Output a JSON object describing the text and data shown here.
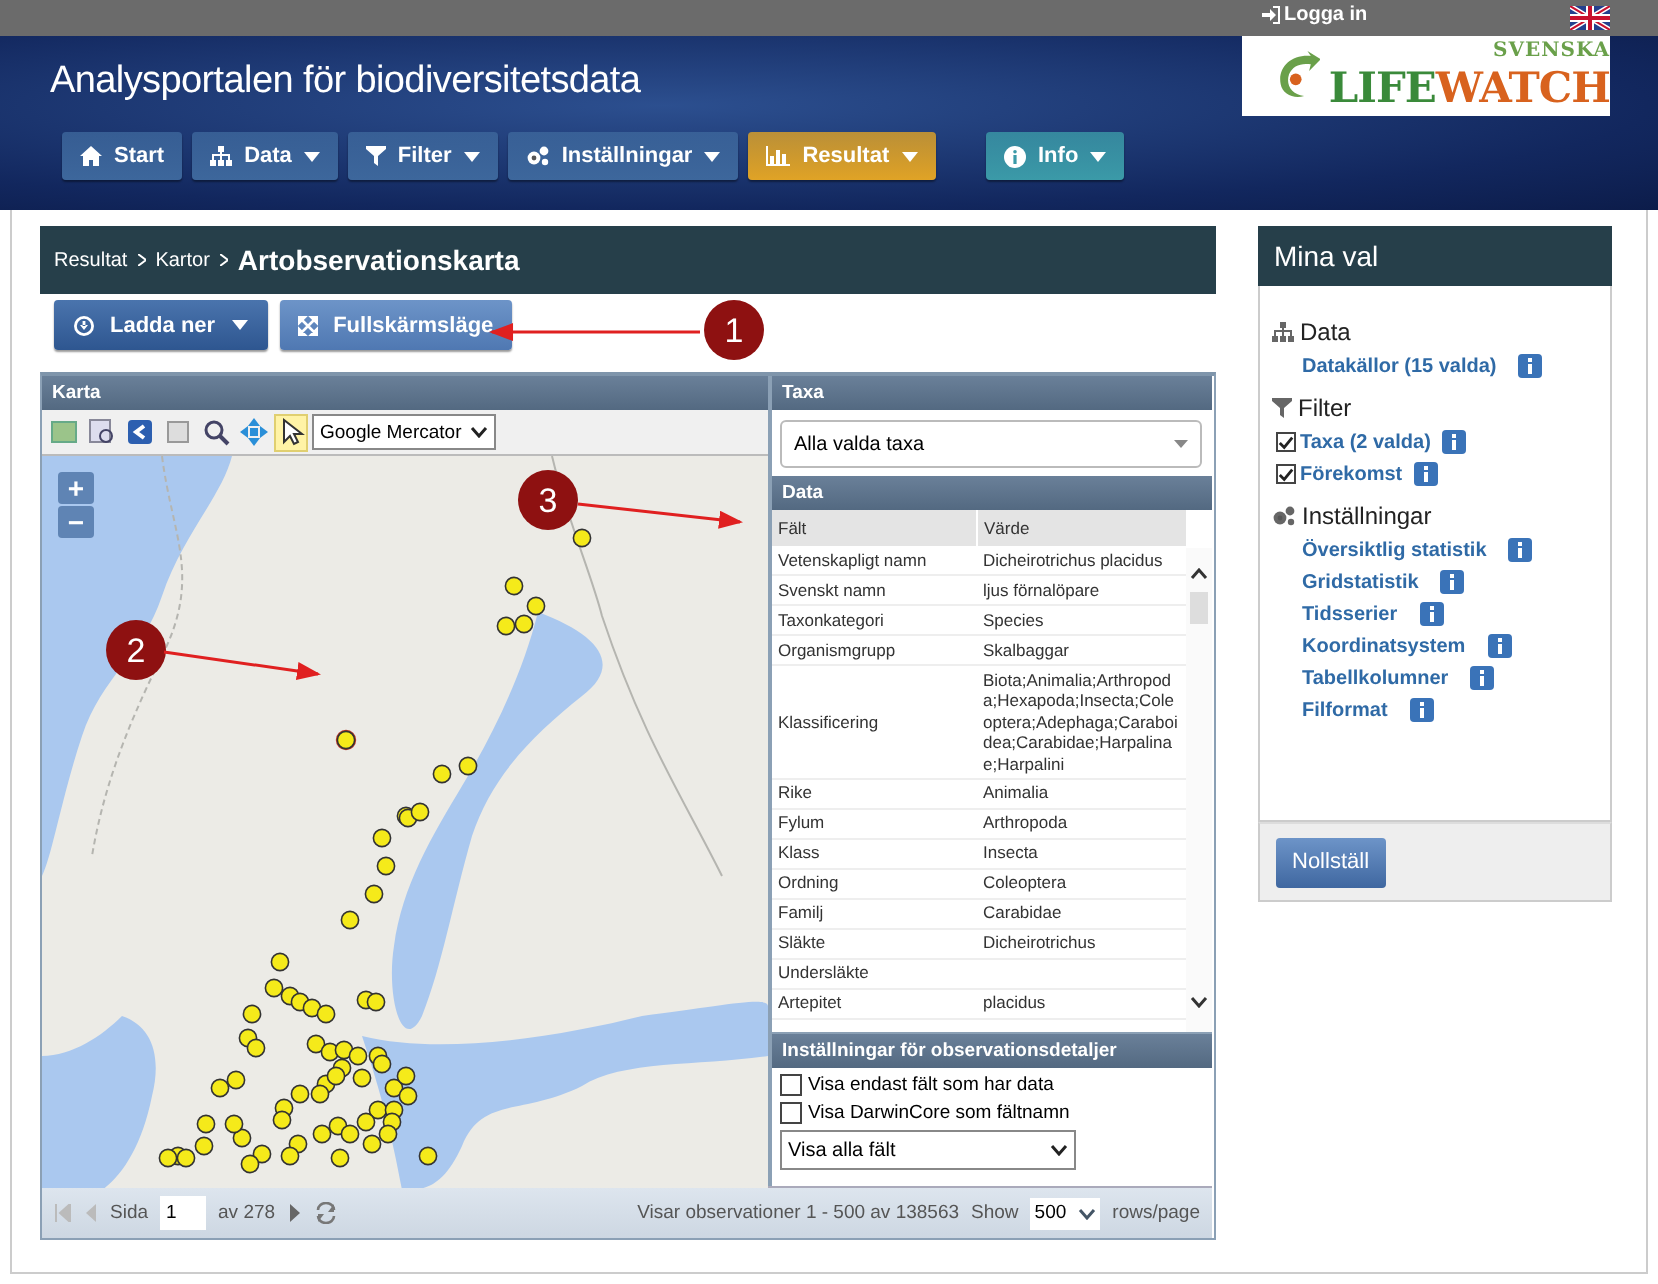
{
  "topbar": {
    "login": "Logga in"
  },
  "header": {
    "title": "Analysportalen för biodiversitetsdata",
    "logo": {
      "top": "SVENSKA",
      "main_1": "LIFE",
      "main_2": "WATCH"
    }
  },
  "nav": [
    {
      "label": "Start",
      "dropdown": false,
      "color": "#3d679c"
    },
    {
      "label": "Data",
      "dropdown": true,
      "color": "#3d679c"
    },
    {
      "label": "Filter",
      "dropdown": true,
      "color": "#3d679c"
    },
    {
      "label": "Inställningar",
      "dropdown": true,
      "color": "#3d679c"
    },
    {
      "label": "Resultat",
      "dropdown": true,
      "color": "#e0a326"
    }
  ],
  "nav_right": [
    {
      "label": "Info",
      "dropdown": true,
      "color": "#3b9aa8"
    }
  ],
  "breadcrumb": [
    "Resultat",
    "Kartor",
    "Artobservationskarta"
  ],
  "actions": [
    {
      "label": "Ladda ner",
      "kind": "download"
    },
    {
      "label": "Fullskärmsläge",
      "kind": "fullscreen"
    }
  ],
  "map": {
    "title": "Karta",
    "tools": [
      {
        "selected": false
      },
      {
        "selected": false
      },
      {
        "selected": false
      },
      {
        "selected": false
      },
      {
        "selected": false
      },
      {
        "selected": false
      },
      {
        "selected": true
      }
    ],
    "projection": "Google Mercator",
    "zoom_in": "+",
    "zoom_out": "−"
  },
  "taxa": {
    "title": "Taxa",
    "value": "Alla valda taxa"
  },
  "data_table": {
    "title": "Data",
    "columns": [
      "Fält",
      "Värde"
    ],
    "rows": [
      {
        "field": "Vetenskapligt namn",
        "value": "Dicheirotrichus placidus"
      },
      {
        "field": "Svenskt namn",
        "value": "ljus förnalöpare"
      },
      {
        "field": "Taxonkategori",
        "value": "Species"
      },
      {
        "field": "Organismgrupp",
        "value": "Skalbaggar"
      },
      {
        "field": "Klassificering",
        "value": "Biota;Animalia;Arthropoda;Hexapoda;Insecta;Coleoptera;Adephaga;Caraboidea;Carabidae;Harpalinae;Harpalini"
      },
      {
        "field": "Rike",
        "value": "Animalia"
      },
      {
        "field": "Fylum",
        "value": "Arthropoda"
      },
      {
        "field": "Klass",
        "value": "Insecta"
      },
      {
        "field": "Ordning",
        "value": "Coleoptera"
      },
      {
        "field": "Familj",
        "value": "Carabidae"
      },
      {
        "field": "Släkte",
        "value": "Dicheirotrichus"
      },
      {
        "field": "Undersläkte",
        "value": ""
      },
      {
        "field": "Artepitet",
        "value": "placidus"
      }
    ]
  },
  "details_settings": {
    "title": "Inställningar för observationsdetaljer",
    "options": [
      {
        "label": "Visa endast fält som har data",
        "checked": false
      },
      {
        "label": "Visa DarwinCore som fältnamn",
        "checked": false
      }
    ],
    "select": "Visa alla fält"
  },
  "pager": {
    "page_label": "Sida",
    "page": "1",
    "of": "av 278",
    "summary": "Visar observationer 1 - 500 av 138563",
    "show_label": "Show",
    "page_size": "500",
    "unit": "rows/page"
  },
  "callouts": [
    "1",
    "2",
    "3"
  ],
  "sidebar": {
    "title": "Mina val",
    "sections": [
      {
        "title": "Data",
        "items": [
          {
            "label": "Datakällor (15 valda)",
            "kind": "link"
          }
        ]
      },
      {
        "title": "Filter",
        "items": [
          {
            "label": "Taxa (2 valda)",
            "kind": "checkbox",
            "checked": true
          },
          {
            "label": "Förekomst",
            "kind": "checkbox",
            "checked": true
          }
        ]
      },
      {
        "title": "Inställningar",
        "items": [
          {
            "label": "Översiktlig statistik",
            "kind": "link"
          },
          {
            "label": "Gridstatistik",
            "kind": "link"
          },
          {
            "label": "Tidsserier",
            "kind": "link"
          },
          {
            "label": "Koordinatsystem",
            "kind": "link"
          },
          {
            "label": "Tabellkolumner",
            "kind": "link"
          },
          {
            "label": "Filformat",
            "kind": "link"
          }
        ]
      }
    ],
    "reset": "Nollställ"
  }
}
